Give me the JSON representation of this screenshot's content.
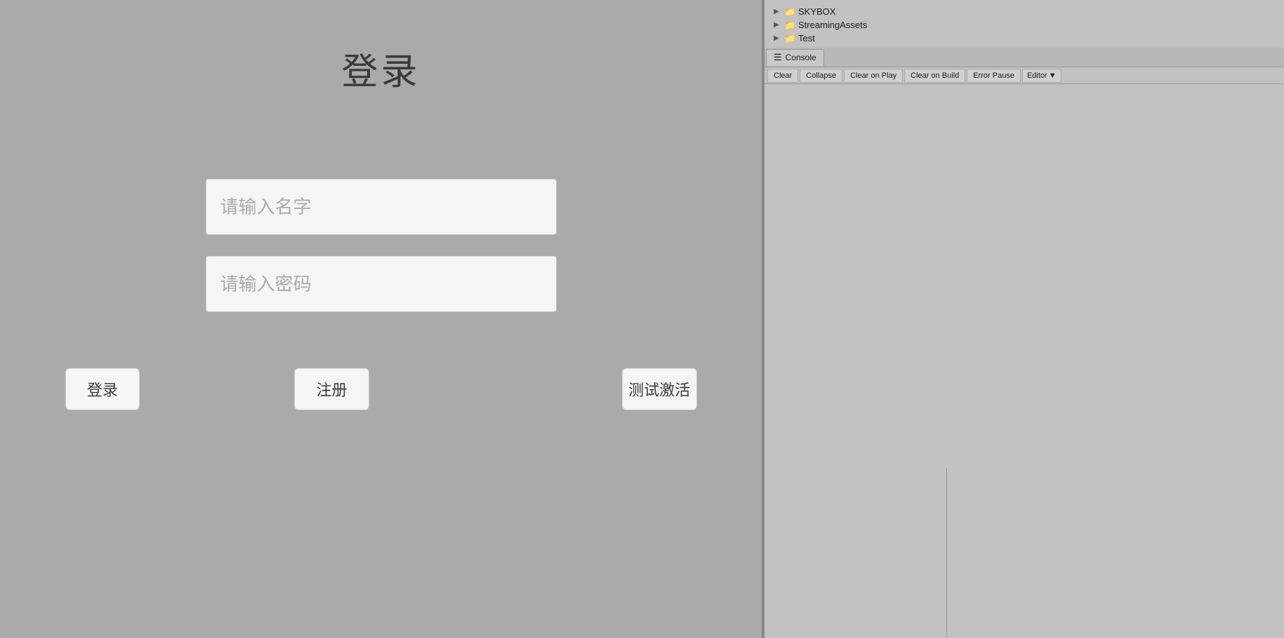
{
  "game_view": {
    "title": "登录",
    "username_placeholder": "请输入名字",
    "password_placeholder": "请输入密码",
    "buttons": {
      "login": "登录",
      "register": "注册",
      "test_activate": "测试激活"
    }
  },
  "project_browser": {
    "items": [
      {
        "label": "SKYBOX"
      },
      {
        "label": "StreamingAssets"
      },
      {
        "label": "Test"
      }
    ]
  },
  "console": {
    "tab_label": "Console",
    "toolbar": {
      "clear": "Clear",
      "collapse": "Collapse",
      "clear_on_play": "Clear on Play",
      "clear_on_build": "Clear on Build",
      "error_pause": "Error Pause",
      "editor": "Editor"
    }
  }
}
